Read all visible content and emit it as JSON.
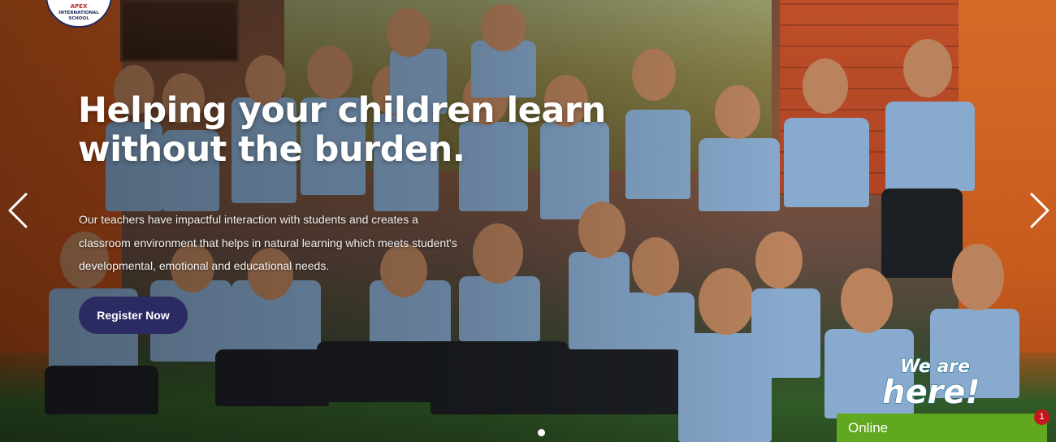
{
  "logo": {
    "line1": "APEX",
    "line2": "INTERNATIONAL",
    "line3": "SCHOOL"
  },
  "hero": {
    "headline": "Helping your children learn without the burden.",
    "subtext": "Our teachers have impactful interaction with students and creates a classroom environment that helps in natural learning which meets student's developmental, emotional and educational needs.",
    "cta_label": "Register Now",
    "accent_color": "#2b2a63",
    "prev_icon": "chevron-left-icon",
    "next_icon": "chevron-right-icon",
    "slides_total": 1,
    "active_slide": 1
  },
  "chat": {
    "promo_text": "We are here!",
    "status_label": "Online",
    "unread_count": "1",
    "status_color": "#5fa81f",
    "badge_color": "#c4161c"
  }
}
